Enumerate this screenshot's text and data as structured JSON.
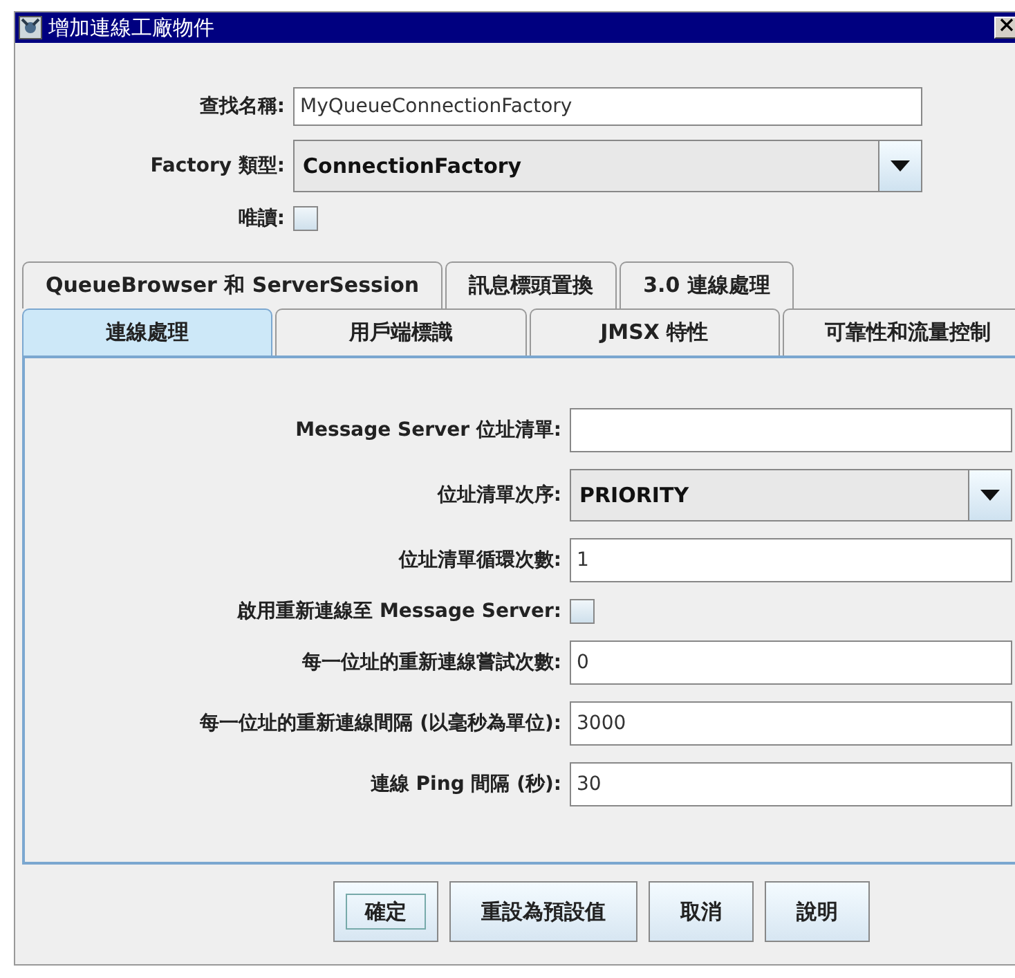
{
  "window": {
    "title": "增加連線工廠物件"
  },
  "top_fields": [
    {
      "kind": "text",
      "label": "查找名稱:",
      "value": "MyQueueConnectionFactory"
    },
    {
      "kind": "combo",
      "label": "Factory 類型:",
      "value": "ConnectionFactory"
    },
    {
      "kind": "checkbox",
      "label": "唯讀:",
      "checked": false
    }
  ],
  "tab_rows": [
    [
      {
        "label": "QueueBrowser 和 ServerSession",
        "selected": false
      },
      {
        "label": "訊息標頭置換",
        "selected": false
      },
      {
        "label": "3.0 連線處理",
        "selected": false
      }
    ],
    [
      {
        "label": "連線處理",
        "selected": true
      },
      {
        "label": "用戶端標識",
        "selected": false
      },
      {
        "label": "JMSX 特性",
        "selected": false
      },
      {
        "label": "可靠性和流量控制",
        "selected": false
      }
    ]
  ],
  "panel_fields": [
    {
      "kind": "text",
      "label": "Message Server 位址清單:"
    },
    {
      "kind": "combo",
      "label": "位址清單次序:",
      "value": "PRIORITY"
    },
    {
      "kind": "text",
      "label": "位址清單循環次數:",
      "value": "1"
    },
    {
      "kind": "checkbox",
      "label": "啟用重新連線至 Message Server:",
      "checked": false
    },
    {
      "kind": "text",
      "label": "每一位址的重新連線嘗試次數:",
      "value": "0"
    },
    {
      "kind": "text",
      "label": "每一位址的重新連線間隔 (以毫秒為單位):",
      "value": "3000"
    },
    {
      "kind": "text",
      "label": "連線 Ping 間隔 (秒):",
      "value": "30"
    }
  ],
  "buttons": [
    {
      "label": "確定",
      "focused": true
    },
    {
      "label": "重設為預設值",
      "focused": false
    },
    {
      "label": "取消",
      "focused": false
    },
    {
      "label": "說明",
      "focused": false
    }
  ]
}
